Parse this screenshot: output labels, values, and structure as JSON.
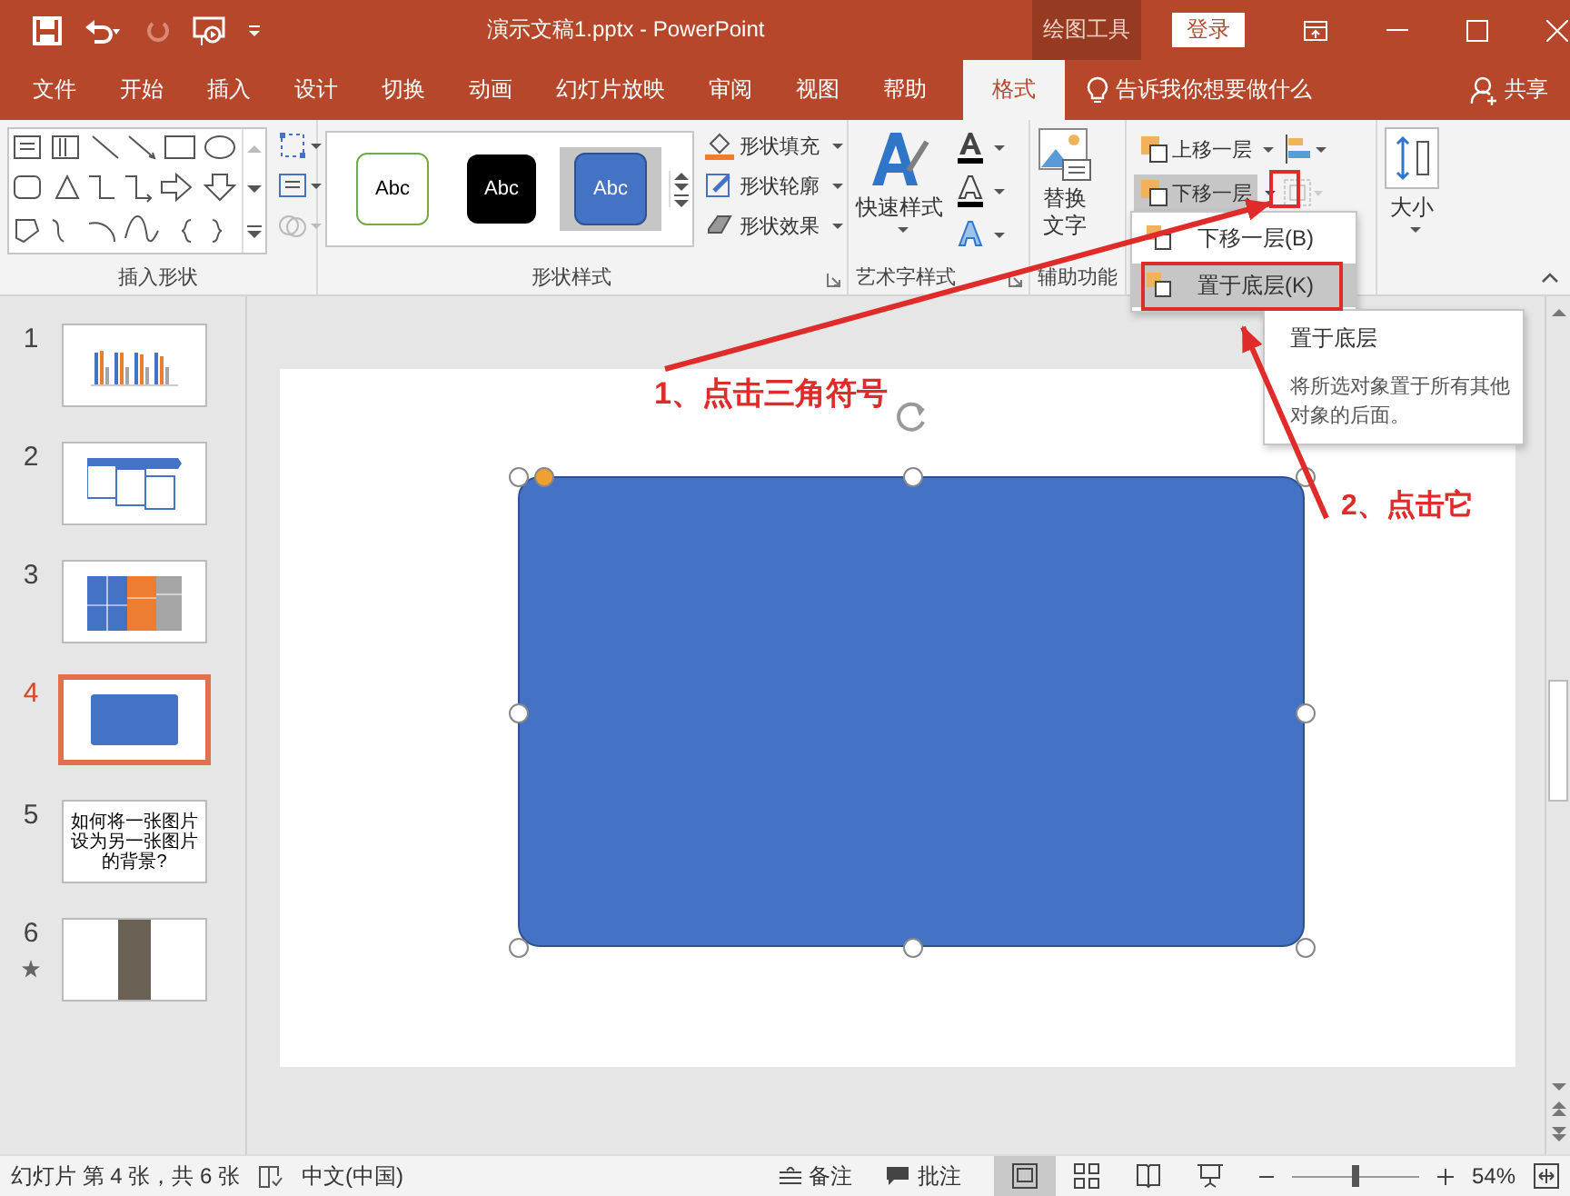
{
  "window": {
    "title": "演示文稿1.pptx  -  PowerPoint",
    "context_tab": "绘图工具",
    "login_button": "登录"
  },
  "tabs": [
    {
      "label": "文件",
      "selected": false
    },
    {
      "label": "开始",
      "selected": false
    },
    {
      "label": "插入",
      "selected": false
    },
    {
      "label": "设计",
      "selected": false
    },
    {
      "label": "切换",
      "selected": false
    },
    {
      "label": "动画",
      "selected": false
    },
    {
      "label": "幻灯片放映",
      "selected": false
    },
    {
      "label": "审阅",
      "selected": false
    },
    {
      "label": "视图",
      "selected": false
    },
    {
      "label": "帮助",
      "selected": false
    },
    {
      "label": "格式",
      "selected": true
    }
  ],
  "tell_me": "告诉我你想要做什么",
  "share": "共享",
  "ribbon": {
    "insert_shapes": {
      "label": "插入形状"
    },
    "shape_styles": {
      "label": "形状样式",
      "presets": [
        {
          "text": "Abc",
          "kind": "outline",
          "selected": false
        },
        {
          "text": "Abc",
          "kind": "dark",
          "selected": false
        },
        {
          "text": "Abc",
          "kind": "blue",
          "selected": true
        }
      ],
      "commands": [
        {
          "label": "形状填充",
          "kind": "fill"
        },
        {
          "label": "形状轮廓",
          "kind": "outline"
        },
        {
          "label": "形状效果",
          "kind": "effects"
        }
      ]
    },
    "wordart": {
      "label": "艺术字样式",
      "quick_styles": "快速样式"
    },
    "accessibility": {
      "label": "辅助功能",
      "alt_text": "替换文字"
    },
    "arrange": {
      "bring_forward": "上移一层",
      "send_backward": "下移一层",
      "send_backward_open": true
    },
    "size": {
      "label": "大小"
    }
  },
  "dropdown": {
    "items": [
      {
        "label": "下移一层(B)",
        "selected": false
      },
      {
        "label": "置于底层(K)",
        "selected": true
      }
    ]
  },
  "tooltip": {
    "title": "置于底层",
    "text": "将所选对象置于所有其他对象的后面。"
  },
  "slides": [
    {
      "number": "1",
      "kind": "chart",
      "selected": false,
      "star": false
    },
    {
      "number": "2",
      "kind": "boxes",
      "selected": false,
      "star": false
    },
    {
      "number": "3",
      "kind": "treemap",
      "selected": false,
      "star": false
    },
    {
      "number": "4",
      "kind": "shape",
      "selected": true,
      "star": false
    },
    {
      "number": "5",
      "kind": "text",
      "selected": false,
      "star": false,
      "text": "如何将一张图片设为另一张图片的背景?"
    },
    {
      "number": "6",
      "kind": "photo",
      "selected": false,
      "star": true
    }
  ],
  "annotations": [
    {
      "text": "1、点击三角符号"
    },
    {
      "text": "2、点击它"
    }
  ],
  "status_bar": {
    "slide_info": "幻灯片 第 4 张，共 6 张",
    "language": "中文(中国)",
    "notes": "备注",
    "comments": "批注",
    "views": [
      {
        "kind": "normal",
        "selected": true
      },
      {
        "kind": "sorter",
        "selected": false
      },
      {
        "kind": "reading",
        "selected": false
      },
      {
        "kind": "show",
        "selected": false
      }
    ],
    "zoom_slider": {
      "level": 0.5
    },
    "zoom": "54%"
  }
}
